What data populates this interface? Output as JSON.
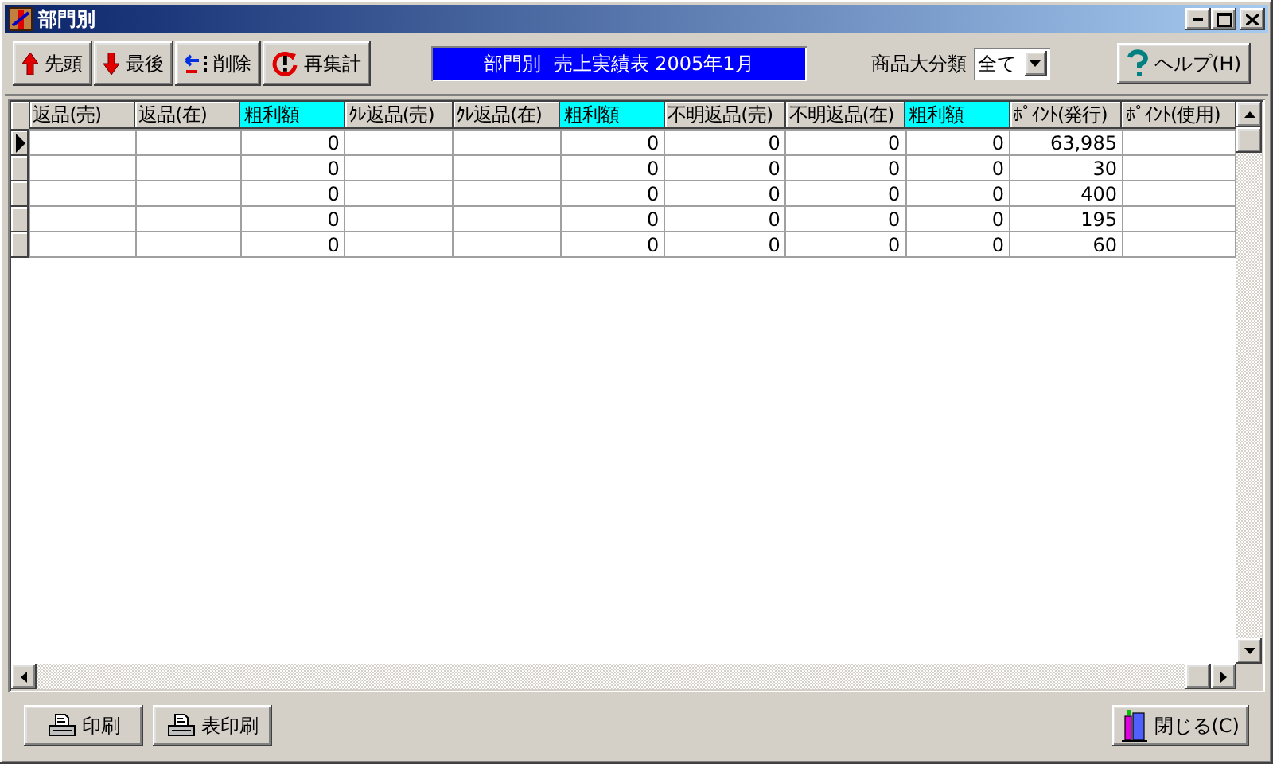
{
  "window": {
    "title": "部門別"
  },
  "toolbar": {
    "buttons": [
      {
        "kind": "first",
        "label": "先頭"
      },
      {
        "kind": "last",
        "label": "最後"
      },
      {
        "kind": "delete",
        "label": "削除"
      },
      {
        "kind": "recount",
        "label": "再集計"
      }
    ],
    "banner": "部門別  売上実績表 2005年1月",
    "category": {
      "label": "商品大分類",
      "value": "全て"
    },
    "help": {
      "label": "ヘルプ(H)"
    }
  },
  "table": {
    "columns": [
      {
        "label": "返品(売)",
        "highlighted": false
      },
      {
        "label": "返品(在)",
        "highlighted": false
      },
      {
        "label": "粗利額",
        "highlighted": true
      },
      {
        "label": "ｸﾚ返品(売)",
        "highlighted": false
      },
      {
        "label": "ｸﾚ返品(在)",
        "highlighted": false
      },
      {
        "label": "粗利額",
        "highlighted": true
      },
      {
        "label": "不明返品(売)",
        "highlighted": false
      },
      {
        "label": "不明返品(在)",
        "highlighted": false
      },
      {
        "label": "粗利額",
        "highlighted": true
      },
      {
        "label": "ﾎﾟｲﾝﾄ(発行)",
        "highlighted": false
      },
      {
        "label": "ﾎﾟｲﾝﾄ(使用)",
        "highlighted": false
      }
    ],
    "rows": [
      {
        "selected": true,
        "cells": [
          null,
          null,
          "0",
          null,
          null,
          "0",
          "0",
          "0",
          "0",
          "63,985",
          null
        ]
      },
      {
        "selected": false,
        "cells": [
          null,
          null,
          "0",
          null,
          null,
          "0",
          "0",
          "0",
          "0",
          "30",
          null
        ]
      },
      {
        "selected": false,
        "cells": [
          null,
          null,
          "0",
          null,
          null,
          "0",
          "0",
          "0",
          "0",
          "400",
          null
        ]
      },
      {
        "selected": false,
        "cells": [
          null,
          null,
          "0",
          null,
          null,
          "0",
          "0",
          "0",
          "0",
          "195",
          null
        ]
      },
      {
        "selected": false,
        "cells": [
          null,
          null,
          "0",
          null,
          null,
          "0",
          "0",
          "0",
          "0",
          "60",
          null
        ]
      }
    ]
  },
  "footer": {
    "buttons": [
      {
        "kind": "print",
        "label": "印刷"
      },
      {
        "kind": "print",
        "label": "表印刷"
      },
      {
        "kind": "close",
        "label": "閉じる(C)"
      }
    ]
  }
}
